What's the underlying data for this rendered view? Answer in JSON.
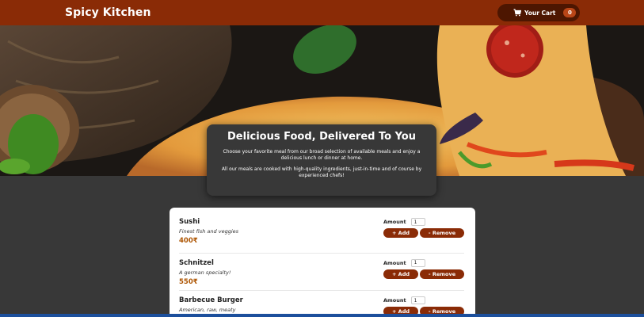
{
  "header": {
    "brand": "Spicy Kitchen",
    "cart_label": "Your Cart",
    "cart_count": "0"
  },
  "summary": {
    "title": "Delicious Food, Delivered To You",
    "paragraph1": "Choose your favorite meal from our broad selection of available meals and enjoy a delicious lunch or dinner at home.",
    "paragraph2": "All our meals are cooked with high-quality ingredients, just-in-time and of course by experienced chefs!"
  },
  "meals": [
    {
      "name": "Sushi",
      "description": "Finest fish and veggies",
      "price": "400₹",
      "amount_label": "Amount",
      "amount": "1",
      "add_label": "+ Add",
      "remove_label": "- Remove"
    },
    {
      "name": "Schnitzel",
      "description": "A german specialty!",
      "price": "550₹",
      "amount_label": "Amount",
      "amount": "1",
      "add_label": "+ Add",
      "remove_label": "- Remove"
    },
    {
      "name": "Barbecue Burger",
      "description": "American, raw, meaty",
      "price": "",
      "amount_label": "Amount",
      "amount": "1",
      "add_label": "+ Add",
      "remove_label": "- Remove"
    }
  ],
  "icons": {
    "cart": "cart-icon"
  },
  "colors": {
    "header": "#8a2b06",
    "cart_button": "#4d1601",
    "badge": "#b94517",
    "price": "#ad5502",
    "page_bg": "#383838"
  }
}
